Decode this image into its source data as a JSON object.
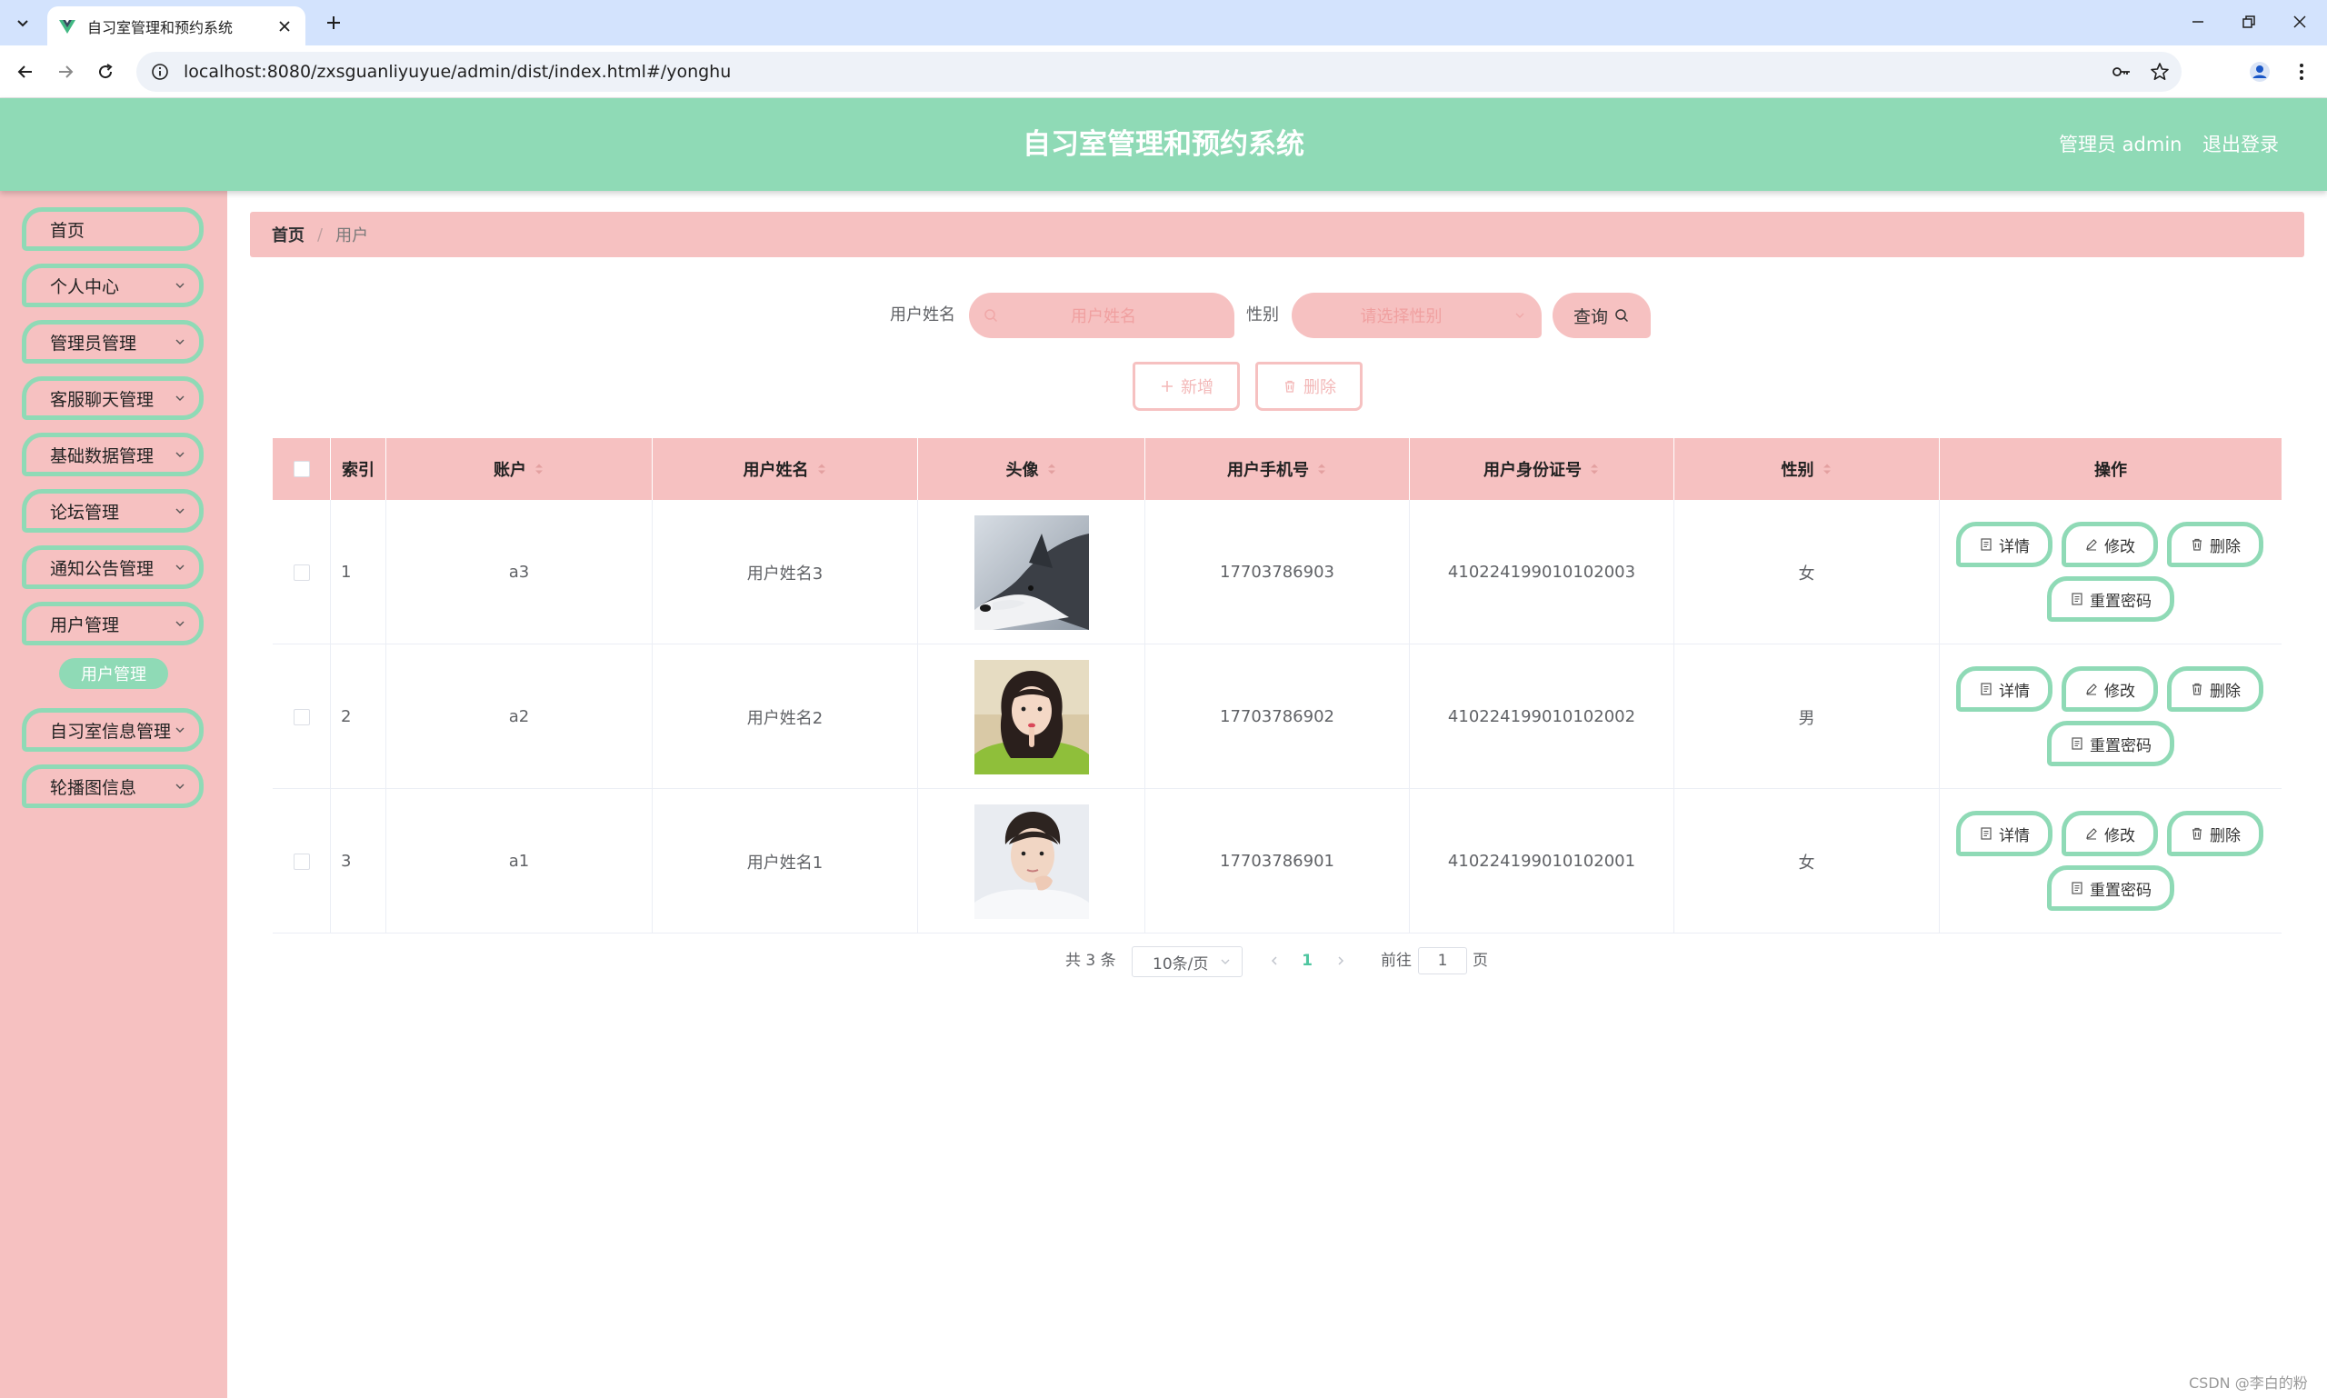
{
  "browser": {
    "tab_title": "自习室管理和预约系统",
    "url": "localhost:8080/zxsguanliyuyue/admin/dist/index.html#/yonghu"
  },
  "header": {
    "title": "自习室管理和预约系统",
    "user": "管理员 admin",
    "logout": "退出登录"
  },
  "sidebar": {
    "items": [
      {
        "label": "首页"
      },
      {
        "label": "个人中心"
      },
      {
        "label": "管理员管理"
      },
      {
        "label": "客服聊天管理"
      },
      {
        "label": "基础数据管理"
      },
      {
        "label": "论坛管理"
      },
      {
        "label": "通知公告管理"
      },
      {
        "label": "用户管理"
      },
      {
        "label": "自习室信息管理"
      },
      {
        "label": "轮播图信息"
      }
    ],
    "submenu_active": "用户管理"
  },
  "breadcrumb": {
    "home": "首页",
    "separator": "/",
    "current": "用户"
  },
  "search": {
    "name_label": "用户姓名",
    "name_placeholder": "用户姓名",
    "gender_label": "性别",
    "gender_placeholder": "请选择性别",
    "query_label": "查询"
  },
  "actions": {
    "add_label": "新增",
    "delete_label": "删除"
  },
  "table": {
    "columns": [
      "索引",
      "账户",
      "用户姓名",
      "头像",
      "用户手机号",
      "用户身份证号",
      "性别",
      "操作"
    ],
    "rows": [
      {
        "index": "1",
        "account": "a3",
        "name": "用户姓名3",
        "avatar": "husky-dog-photo",
        "phone": "17703786903",
        "id_card": "410224199010102003",
        "gender": "女"
      },
      {
        "index": "2",
        "account": "a2",
        "name": "用户姓名2",
        "avatar": "girl-portrait-photo",
        "phone": "17703786902",
        "id_card": "410224199010102002",
        "gender": "男"
      },
      {
        "index": "3",
        "account": "a1",
        "name": "用户姓名1",
        "avatar": "boy-portrait-photo",
        "phone": "17703786901",
        "id_card": "410224199010102001",
        "gender": "女"
      }
    ],
    "op_labels": {
      "detail": "详情",
      "edit": "修改",
      "delete": "删除",
      "reset_password": "重置密码"
    }
  },
  "pagination": {
    "total": "共 3 条",
    "page_size": "10条/页",
    "current_page": "1",
    "goto_label": "前往",
    "goto_value": "1",
    "page_suffix": "页"
  },
  "watermark": "CSDN @李白的粉",
  "colors": {
    "header_green": "#8fdab6",
    "sidebar_pink": "#f6c1c1",
    "active_page": "#4fc6a0"
  }
}
